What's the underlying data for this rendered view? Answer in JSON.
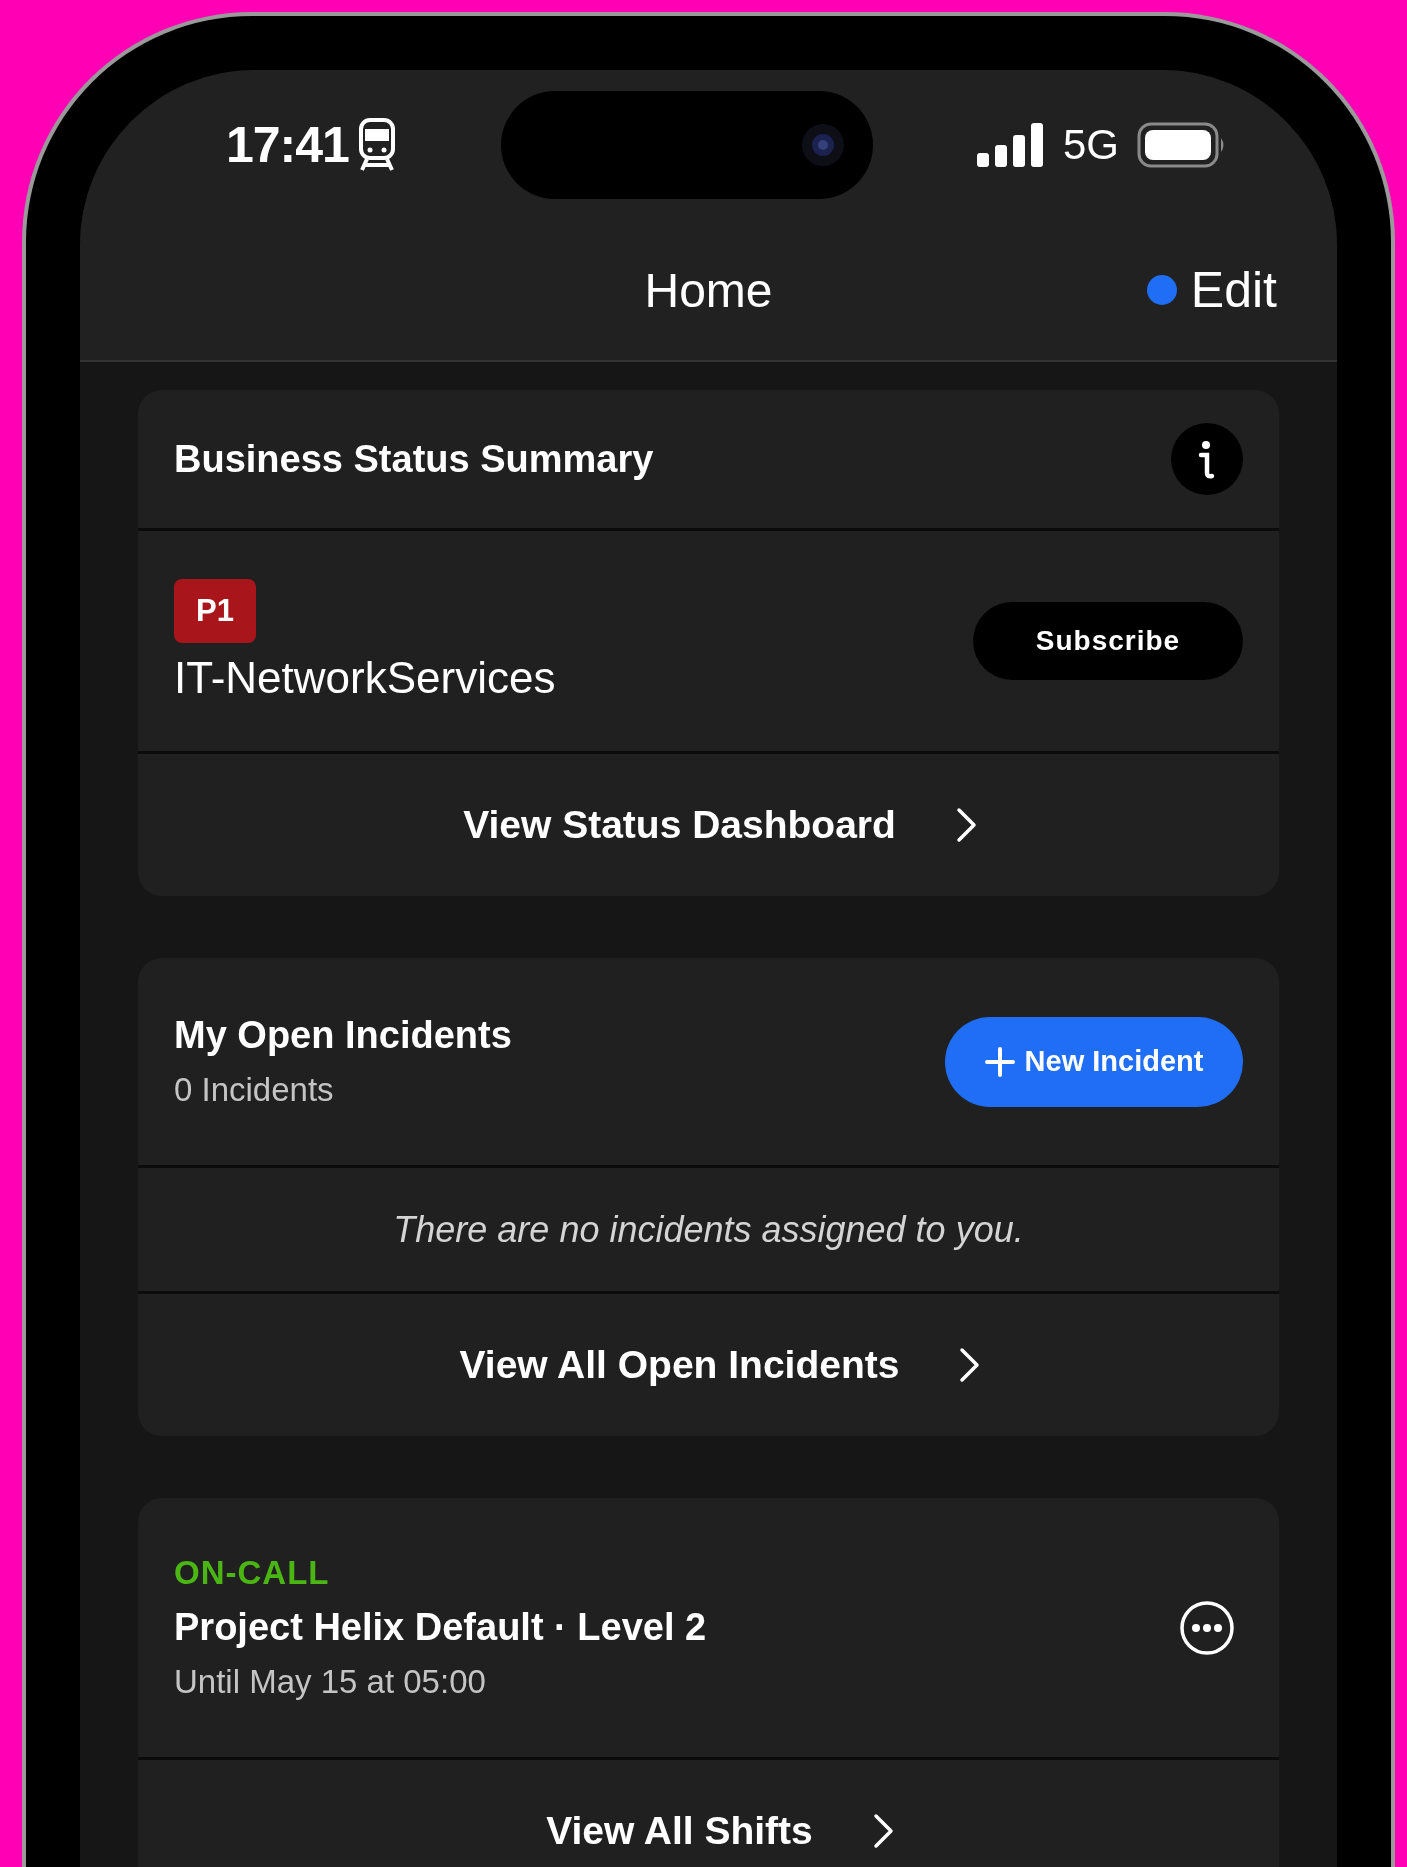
{
  "status_bar": {
    "time": "17:41",
    "network": "5G"
  },
  "nav": {
    "title": "Home",
    "action": "Edit"
  },
  "business_status": {
    "title": "Business Status Summary",
    "priority": "P1",
    "service": "IT-NetworkServices",
    "subscribe": "Subscribe",
    "link": "View Status Dashboard"
  },
  "incidents": {
    "title": "My Open Incidents",
    "count": "0 Incidents",
    "new_button": "New Incident",
    "empty_message": "There are no incidents assigned to you.",
    "link": "View All Open Incidents"
  },
  "on_call": {
    "label": "ON-CALL",
    "title": "Project Helix Default · Level 2",
    "until": "Until May 15 at 05:00",
    "link": "View All Shifts"
  }
}
